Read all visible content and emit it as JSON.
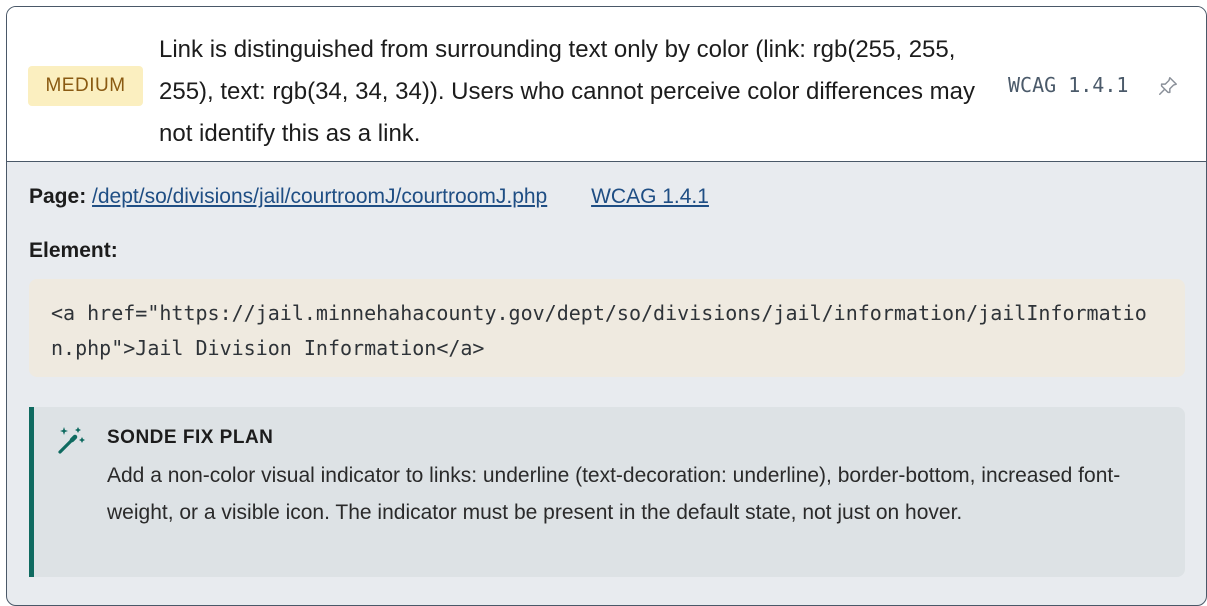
{
  "issue": {
    "severity": "MEDIUM",
    "description": "Link is distinguished from surrounding text only by color (link: rgb(255, 255, 255), text: rgb(34, 34, 34)). Users who cannot perceive color differences may not identify this as a link.",
    "wcag_code": "WCAG 1.4.1",
    "pin_icon": "pin-icon"
  },
  "details": {
    "page_label": "Page:",
    "page_path": "/dept/so/divisions/jail/courtroomJ/courtroomJ.php",
    "wcag_link": "WCAG 1.4.1",
    "element_label": "Element:",
    "element_code": "<a href=\"https://jail.minnehahacounty.gov/dept/so/divisions/jail/information/jailInformation.php\">Jail Division Information</a>"
  },
  "fix_plan": {
    "icon": "magic-wand-icon",
    "title": "SONDE FIX PLAN",
    "text": "Add a non-color visual indicator to links: underline (text-decoration: underline), border-bottom, increased font-weight, or a visible icon. The indicator must be present in the default state, not just on hover."
  },
  "colors": {
    "badge_bg": "#fbefc0",
    "badge_text": "#8a5a12",
    "link": "#1f4e84",
    "fix_accent": "#0f6a60",
    "code_bg": "#efeae0"
  }
}
